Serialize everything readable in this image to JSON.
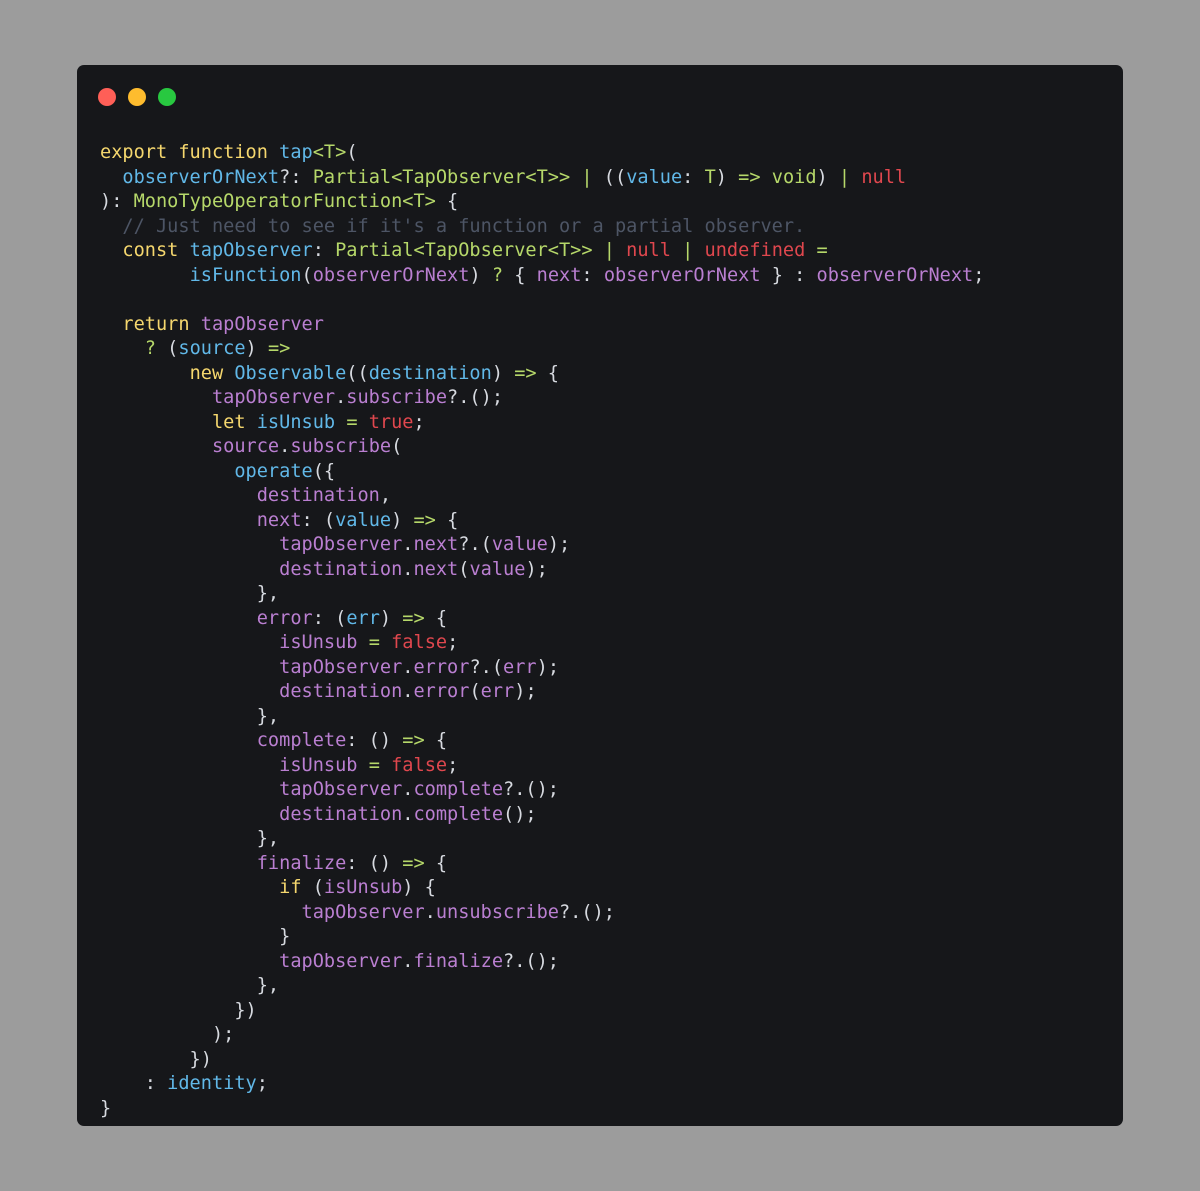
{
  "window": {
    "buttons": [
      "close",
      "minimize",
      "maximize"
    ]
  },
  "colors": {
    "background": "#9c9c9c",
    "editor": "#16171a",
    "keyword": "#f5d76e",
    "function": "#61b8e8",
    "type": "#b6d86a",
    "variable": "#ba7fd1",
    "literal": "#e0474e",
    "comment": "#4d5565",
    "punctuation": "#d7dae0"
  },
  "code": {
    "lines": [
      [
        [
          "kw",
          "export function "
        ],
        [
          "fn",
          "tap"
        ],
        [
          "op",
          "<T>"
        ],
        [
          "pun",
          "("
        ]
      ],
      [
        [
          "pun",
          "  "
        ],
        [
          "par",
          "observerOrNext"
        ],
        [
          "pun",
          "?: "
        ],
        [
          "typ",
          "Partial<TapObserver<T>>"
        ],
        [
          "op",
          " | "
        ],
        [
          "pun",
          "(("
        ],
        [
          "par",
          "value"
        ],
        [
          "pun",
          ": "
        ],
        [
          "typ",
          "T"
        ],
        [
          "pun",
          ") "
        ],
        [
          "op",
          "=>"
        ],
        [
          "pun",
          " "
        ],
        [
          "typ",
          "void"
        ],
        [
          "pun",
          ") "
        ],
        [
          "op",
          "|"
        ],
        [
          "pun",
          " "
        ],
        [
          "red",
          "null"
        ]
      ],
      [
        [
          "pun",
          "): "
        ],
        [
          "typ",
          "MonoTypeOperatorFunction<T>"
        ],
        [
          "pun",
          " {"
        ]
      ],
      [
        [
          "cm",
          "  // Just need to see if it's a function or a partial observer."
        ]
      ],
      [
        [
          "pun",
          "  "
        ],
        [
          "kw",
          "const "
        ],
        [
          "fn",
          "tapObserver"
        ],
        [
          "pun",
          ": "
        ],
        [
          "typ",
          "Partial<TapObserver<T>>"
        ],
        [
          "op",
          " | "
        ],
        [
          "red",
          "null"
        ],
        [
          "op",
          " | "
        ],
        [
          "red",
          "undefined"
        ],
        [
          "pun",
          " "
        ],
        [
          "op",
          "="
        ]
      ],
      [
        [
          "pun",
          "        "
        ],
        [
          "fn",
          "isFunction"
        ],
        [
          "pun",
          "("
        ],
        [
          "var",
          "observerOrNext"
        ],
        [
          "pun",
          ") "
        ],
        [
          "op",
          "?"
        ],
        [
          "pun",
          " { "
        ],
        [
          "var",
          "next"
        ],
        [
          "pun",
          ": "
        ],
        [
          "var",
          "observerOrNext"
        ],
        [
          "pun",
          " } : "
        ],
        [
          "var",
          "observerOrNext"
        ],
        [
          "pun",
          ";"
        ]
      ],
      [],
      [
        [
          "pun",
          "  "
        ],
        [
          "kw",
          "return "
        ],
        [
          "var",
          "tapObserver"
        ]
      ],
      [
        [
          "pun",
          "    "
        ],
        [
          "op",
          "?"
        ],
        [
          "pun",
          " ("
        ],
        [
          "par",
          "source"
        ],
        [
          "pun",
          ") "
        ],
        [
          "op",
          "=>"
        ]
      ],
      [
        [
          "pun",
          "        "
        ],
        [
          "kw",
          "new "
        ],
        [
          "fn",
          "Observable"
        ],
        [
          "pun",
          "(("
        ],
        [
          "par",
          "destination"
        ],
        [
          "pun",
          ") "
        ],
        [
          "op",
          "=>"
        ],
        [
          "pun",
          " {"
        ]
      ],
      [
        [
          "pun",
          "          "
        ],
        [
          "var",
          "tapObserver"
        ],
        [
          "pun",
          "."
        ],
        [
          "var",
          "subscribe"
        ],
        [
          "pun",
          "?.();"
        ]
      ],
      [
        [
          "pun",
          "          "
        ],
        [
          "kw",
          "let "
        ],
        [
          "fn",
          "isUnsub"
        ],
        [
          "pun",
          " "
        ],
        [
          "op",
          "="
        ],
        [
          "pun",
          " "
        ],
        [
          "red",
          "true"
        ],
        [
          "pun",
          ";"
        ]
      ],
      [
        [
          "pun",
          "          "
        ],
        [
          "var",
          "source"
        ],
        [
          "pun",
          "."
        ],
        [
          "var",
          "subscribe"
        ],
        [
          "pun",
          "("
        ]
      ],
      [
        [
          "pun",
          "            "
        ],
        [
          "fn",
          "operate"
        ],
        [
          "pun",
          "({"
        ]
      ],
      [
        [
          "pun",
          "              "
        ],
        [
          "var",
          "destination"
        ],
        [
          "pun",
          ","
        ]
      ],
      [
        [
          "pun",
          "              "
        ],
        [
          "var",
          "next"
        ],
        [
          "pun",
          ": ("
        ],
        [
          "par",
          "value"
        ],
        [
          "pun",
          ") "
        ],
        [
          "op",
          "=>"
        ],
        [
          "pun",
          " {"
        ]
      ],
      [
        [
          "pun",
          "                "
        ],
        [
          "var",
          "tapObserver"
        ],
        [
          "pun",
          "."
        ],
        [
          "var",
          "next"
        ],
        [
          "pun",
          "?.("
        ],
        [
          "var",
          "value"
        ],
        [
          "pun",
          ");"
        ]
      ],
      [
        [
          "pun",
          "                "
        ],
        [
          "var",
          "destination"
        ],
        [
          "pun",
          "."
        ],
        [
          "var",
          "next"
        ],
        [
          "pun",
          "("
        ],
        [
          "var",
          "value"
        ],
        [
          "pun",
          ");"
        ]
      ],
      [
        [
          "pun",
          "              },"
        ]
      ],
      [
        [
          "pun",
          "              "
        ],
        [
          "var",
          "error"
        ],
        [
          "pun",
          ": ("
        ],
        [
          "par",
          "err"
        ],
        [
          "pun",
          ") "
        ],
        [
          "op",
          "=>"
        ],
        [
          "pun",
          " {"
        ]
      ],
      [
        [
          "pun",
          "                "
        ],
        [
          "var",
          "isUnsub"
        ],
        [
          "pun",
          " "
        ],
        [
          "op",
          "="
        ],
        [
          "pun",
          " "
        ],
        [
          "red",
          "false"
        ],
        [
          "pun",
          ";"
        ]
      ],
      [
        [
          "pun",
          "                "
        ],
        [
          "var",
          "tapObserver"
        ],
        [
          "pun",
          "."
        ],
        [
          "var",
          "error"
        ],
        [
          "pun",
          "?.("
        ],
        [
          "var",
          "err"
        ],
        [
          "pun",
          ");"
        ]
      ],
      [
        [
          "pun",
          "                "
        ],
        [
          "var",
          "destination"
        ],
        [
          "pun",
          "."
        ],
        [
          "var",
          "error"
        ],
        [
          "pun",
          "("
        ],
        [
          "var",
          "err"
        ],
        [
          "pun",
          ");"
        ]
      ],
      [
        [
          "pun",
          "              },"
        ]
      ],
      [
        [
          "pun",
          "              "
        ],
        [
          "var",
          "complete"
        ],
        [
          "pun",
          ": () "
        ],
        [
          "op",
          "=>"
        ],
        [
          "pun",
          " {"
        ]
      ],
      [
        [
          "pun",
          "                "
        ],
        [
          "var",
          "isUnsub"
        ],
        [
          "pun",
          " "
        ],
        [
          "op",
          "="
        ],
        [
          "pun",
          " "
        ],
        [
          "red",
          "false"
        ],
        [
          "pun",
          ";"
        ]
      ],
      [
        [
          "pun",
          "                "
        ],
        [
          "var",
          "tapObserver"
        ],
        [
          "pun",
          "."
        ],
        [
          "var",
          "complete"
        ],
        [
          "pun",
          "?.();"
        ]
      ],
      [
        [
          "pun",
          "                "
        ],
        [
          "var",
          "destination"
        ],
        [
          "pun",
          "."
        ],
        [
          "var",
          "complete"
        ],
        [
          "pun",
          "();"
        ]
      ],
      [
        [
          "pun",
          "              },"
        ]
      ],
      [
        [
          "pun",
          "              "
        ],
        [
          "var",
          "finalize"
        ],
        [
          "pun",
          ": () "
        ],
        [
          "op",
          "=>"
        ],
        [
          "pun",
          " {"
        ]
      ],
      [
        [
          "pun",
          "                "
        ],
        [
          "kw",
          "if "
        ],
        [
          "pun",
          "("
        ],
        [
          "var",
          "isUnsub"
        ],
        [
          "pun",
          ") {"
        ]
      ],
      [
        [
          "pun",
          "                  "
        ],
        [
          "var",
          "tapObserver"
        ],
        [
          "pun",
          "."
        ],
        [
          "var",
          "unsubscribe"
        ],
        [
          "pun",
          "?.();"
        ]
      ],
      [
        [
          "pun",
          "                }"
        ]
      ],
      [
        [
          "pun",
          "                "
        ],
        [
          "var",
          "tapObserver"
        ],
        [
          "pun",
          "."
        ],
        [
          "var",
          "finalize"
        ],
        [
          "pun",
          "?.();"
        ]
      ],
      [
        [
          "pun",
          "              },"
        ]
      ],
      [
        [
          "pun",
          "            })"
        ]
      ],
      [
        [
          "pun",
          "          );"
        ]
      ],
      [
        [
          "pun",
          "        })"
        ]
      ],
      [
        [
          "pun",
          "    : "
        ],
        [
          "fn",
          "identity"
        ],
        [
          "pun",
          ";"
        ]
      ],
      [
        [
          "pun",
          "}"
        ]
      ]
    ]
  }
}
